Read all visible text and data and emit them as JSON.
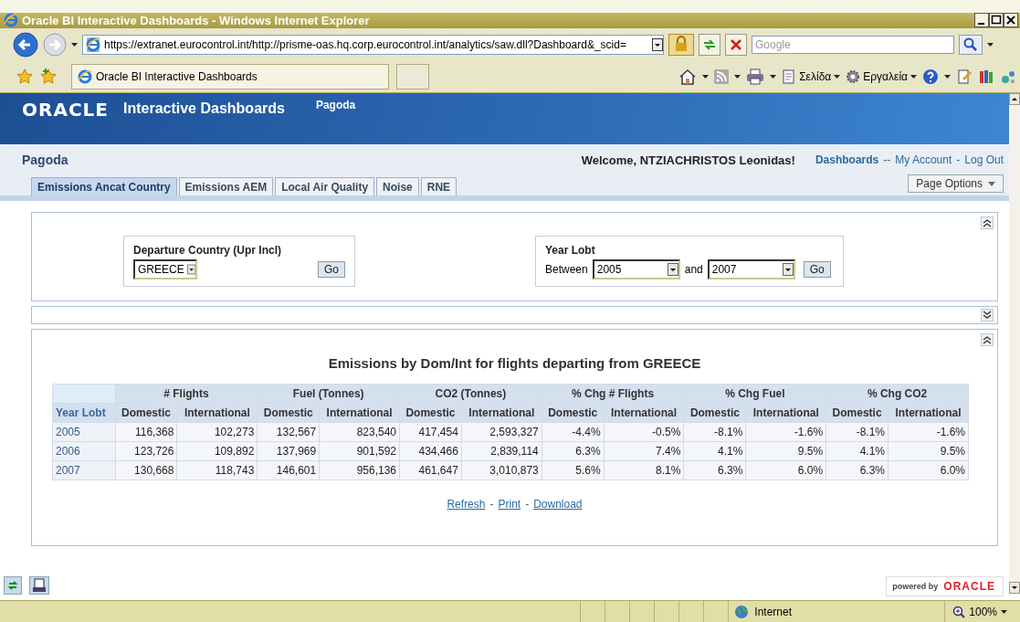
{
  "window": {
    "title": "Oracle BI Interactive Dashboards - Windows Internet Explorer"
  },
  "browser": {
    "address": "https://extranet.eurocontrol.int/http://prisme-oas.hq.corp.eurocontrol.int/analytics/saw.dll?Dashboard&_scid=",
    "search_placeholder": "Google",
    "tab_title": "Oracle BI Interactive Dashboards",
    "menus": [
      "Σελίδα",
      "Εργαλεία"
    ]
  },
  "header": {
    "logo": "ORACLE",
    "product": "Interactive Dashboards",
    "dashboard": "Pagoda"
  },
  "page": {
    "title": "Pagoda",
    "welcome": "Welcome, NTZIACHRISTOS Leonidas!",
    "links": [
      {
        "label": "Dashboards",
        "sep": "--"
      },
      {
        "label": "My Account",
        "sep": "-"
      },
      {
        "label": "Log Out"
      }
    ],
    "page_options": "Page Options",
    "tabs": [
      {
        "label": "Emissions Ancat Country",
        "selected": true
      },
      {
        "label": "Emissions AEM",
        "selected": false
      },
      {
        "label": "Local Air Quality",
        "selected": false
      },
      {
        "label": "Noise",
        "selected": false
      },
      {
        "label": "RNE",
        "selected": false
      }
    ]
  },
  "prompts": [
    {
      "label": "Departure Country (Upr Incl)",
      "kind": "single",
      "value": "GREECE",
      "button": "Go"
    },
    {
      "label": "Year Lobt",
      "kind": "between",
      "prefix": "Between",
      "from": "2005",
      "joiner": "and",
      "to": "2007",
      "button": "Go"
    }
  ],
  "report": {
    "title": "Emissions by Dom/Int for flights departing from GREECE",
    "row_header": "Year Lobt",
    "groups": [
      {
        "label": "# Flights",
        "columns": [
          "Domestic",
          "International"
        ]
      },
      {
        "label": "Fuel (Tonnes)",
        "columns": [
          "Domestic",
          "International"
        ]
      },
      {
        "label": "CO2 (Tonnes)",
        "columns": [
          "Domestic",
          "International"
        ]
      },
      {
        "label": "% Chg # Flights",
        "columns": [
          "Domestic",
          "International"
        ]
      },
      {
        "label": "% Chg Fuel",
        "columns": [
          "Domestic",
          "International"
        ]
      },
      {
        "label": "% Chg CO2",
        "columns": [
          "Domestic",
          "International"
        ]
      }
    ],
    "rows": [
      {
        "year": "2005",
        "cells": [
          "116,368",
          "102,273",
          "132,567",
          "823,540",
          "417,454",
          "2,593,327",
          "-4.4%",
          "-0.5%",
          "-8.1%",
          "-1.6%",
          "-8.1%",
          "-1.6%"
        ]
      },
      {
        "year": "2006",
        "cells": [
          "123,726",
          "109,892",
          "137,969",
          "901,592",
          "434,466",
          "2,839,114",
          "6.3%",
          "7.4%",
          "4.1%",
          "9.5%",
          "4.1%",
          "9.5%"
        ]
      },
      {
        "year": "2007",
        "cells": [
          "130,668",
          "118,743",
          "146,601",
          "956,136",
          "461,647",
          "3,010,873",
          "5.6%",
          "8.1%",
          "6.3%",
          "6.0%",
          "6.3%",
          "6.0%"
        ]
      }
    ],
    "links": [
      {
        "label": "Refresh"
      },
      {
        "label": "Print",
        "sep": "-"
      },
      {
        "label": "Download",
        "sep": "-"
      }
    ]
  },
  "footer": {
    "powered_by": "powered by",
    "logo": "ORACLE"
  },
  "status_bar": {
    "zone": "Internet",
    "zoom": "100%"
  }
}
